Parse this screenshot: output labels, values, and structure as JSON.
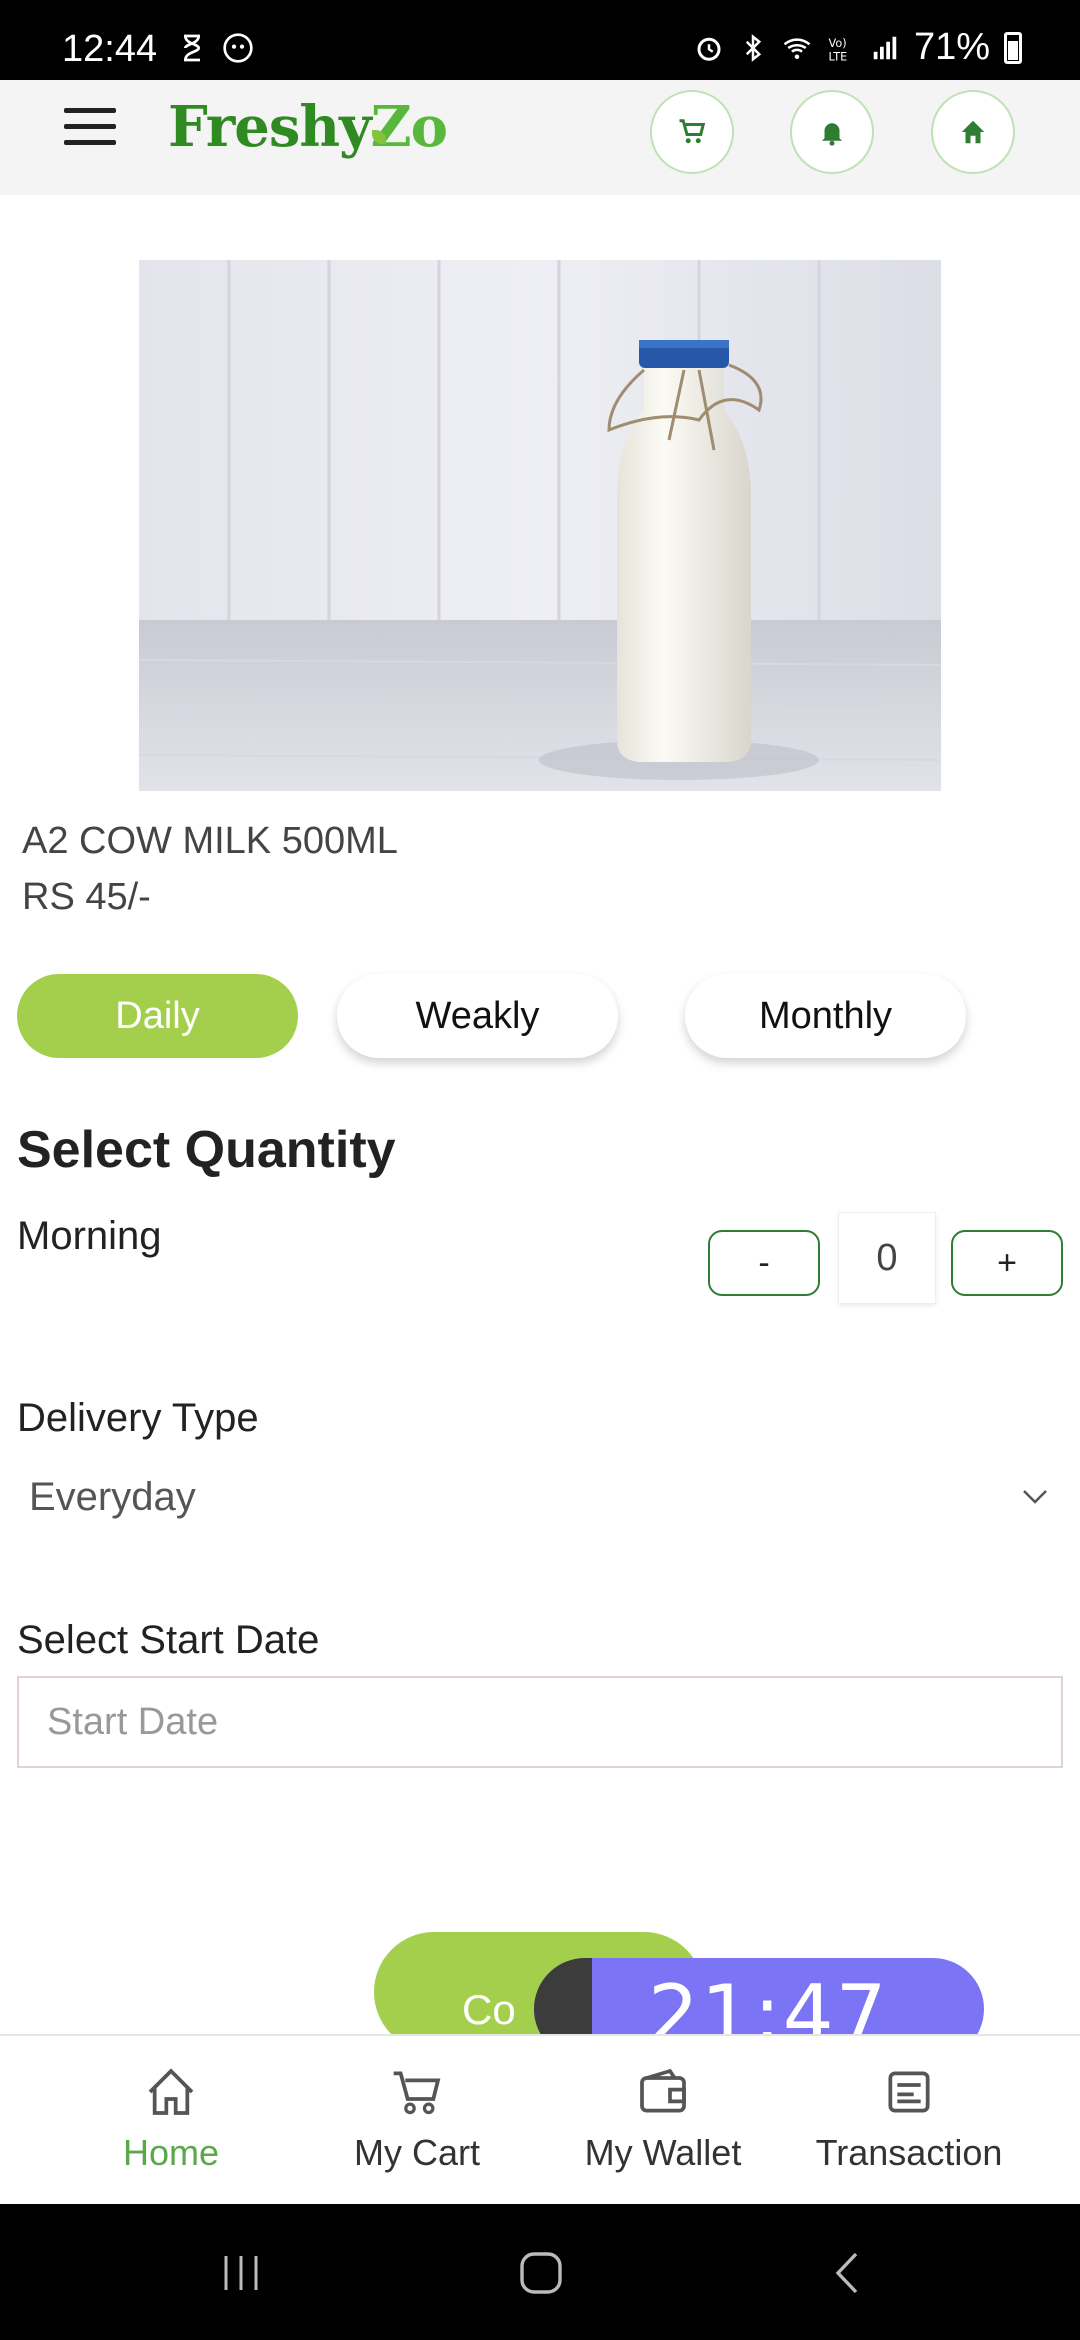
{
  "status_bar": {
    "time": "12:44",
    "battery": "71%"
  },
  "header": {
    "logo_part1": "Freshy",
    "logo_part2": "Zo",
    "icons": [
      "menu-icon",
      "cart-icon",
      "bell-icon",
      "home-icon"
    ]
  },
  "product": {
    "name": "A2 COW MILK 500ML",
    "price": "RS 45/-"
  },
  "frequency_tabs": [
    {
      "label": "Daily",
      "active": true
    },
    {
      "label": "Weakly",
      "active": false
    },
    {
      "label": "Monthly",
      "active": false
    }
  ],
  "quantity": {
    "title": "Select Quantity",
    "slot_label": "Morning",
    "minus_label": "-",
    "plus_label": "+",
    "value": "0"
  },
  "delivery": {
    "label": "Delivery Type",
    "value": "Everyday"
  },
  "start_date": {
    "label": "Select Start Date",
    "placeholder": "Start Date"
  },
  "continue_label": "Co",
  "timer": "21:47",
  "bottom_nav": [
    {
      "label": "Home",
      "icon": "home-icon",
      "active": true
    },
    {
      "label": "My Cart",
      "icon": "cart-icon",
      "active": false
    },
    {
      "label": "My Wallet",
      "icon": "wallet-icon",
      "active": false
    },
    {
      "label": "Transaction",
      "icon": "transaction-icon",
      "active": false
    }
  ],
  "colors": {
    "accent_green": "#a4cf4c",
    "brand_green": "#2f8a22",
    "active_nav": "#5aa84a",
    "timer_purple": "#7b74f4"
  }
}
